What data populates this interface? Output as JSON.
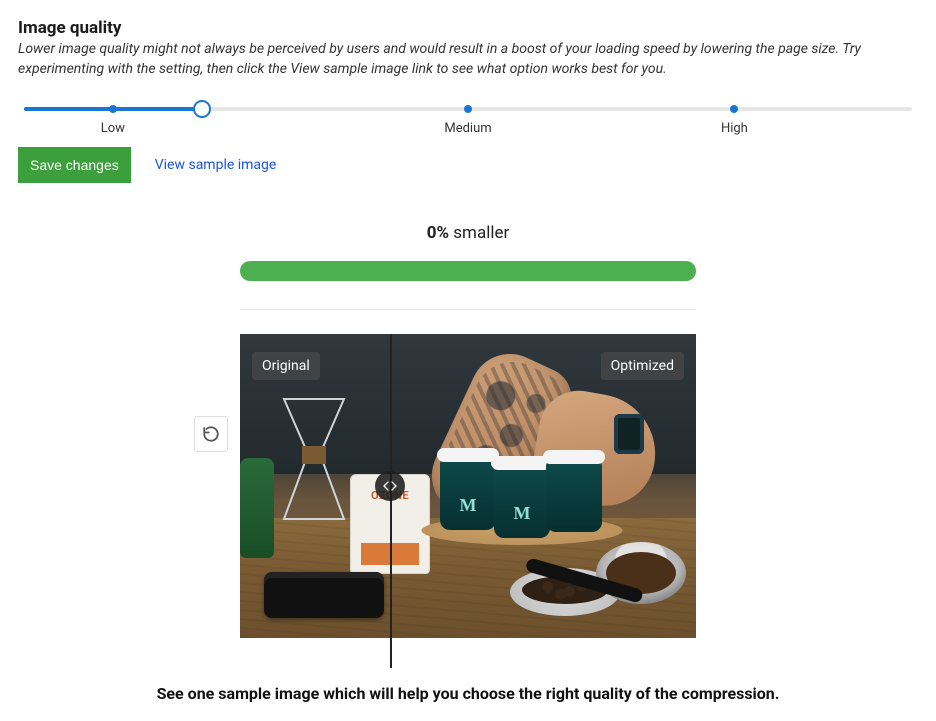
{
  "section": {
    "title": "Image quality",
    "description": "Lower image quality might not always be perceived by users and would result in a boost of your loading speed by lowering the page size. Try experimenting with the setting, then click the View sample image link to see what option works best for you."
  },
  "slider": {
    "labels": {
      "low": "Low",
      "medium": "Medium",
      "high": "High"
    },
    "value_percent": 20
  },
  "actions": {
    "save_label": "Save changes",
    "view_sample_label": "View sample image"
  },
  "result": {
    "percent_text": "0%",
    "smaller_word": "smaller",
    "bar_fill_percent": 100
  },
  "compare": {
    "original_label": "Original",
    "optimized_label": "Optimized",
    "divider_percent": 33
  },
  "caption": "See one sample image which will help you choose the right quality of the compression.",
  "icons": {
    "refresh": "refresh-icon",
    "compare_handle": "compare-handle-icon"
  },
  "colors": {
    "accent_blue": "#1976d2",
    "button_green": "#3ba03b",
    "bar_green": "#4caf50",
    "link_blue": "#1a53e6"
  }
}
